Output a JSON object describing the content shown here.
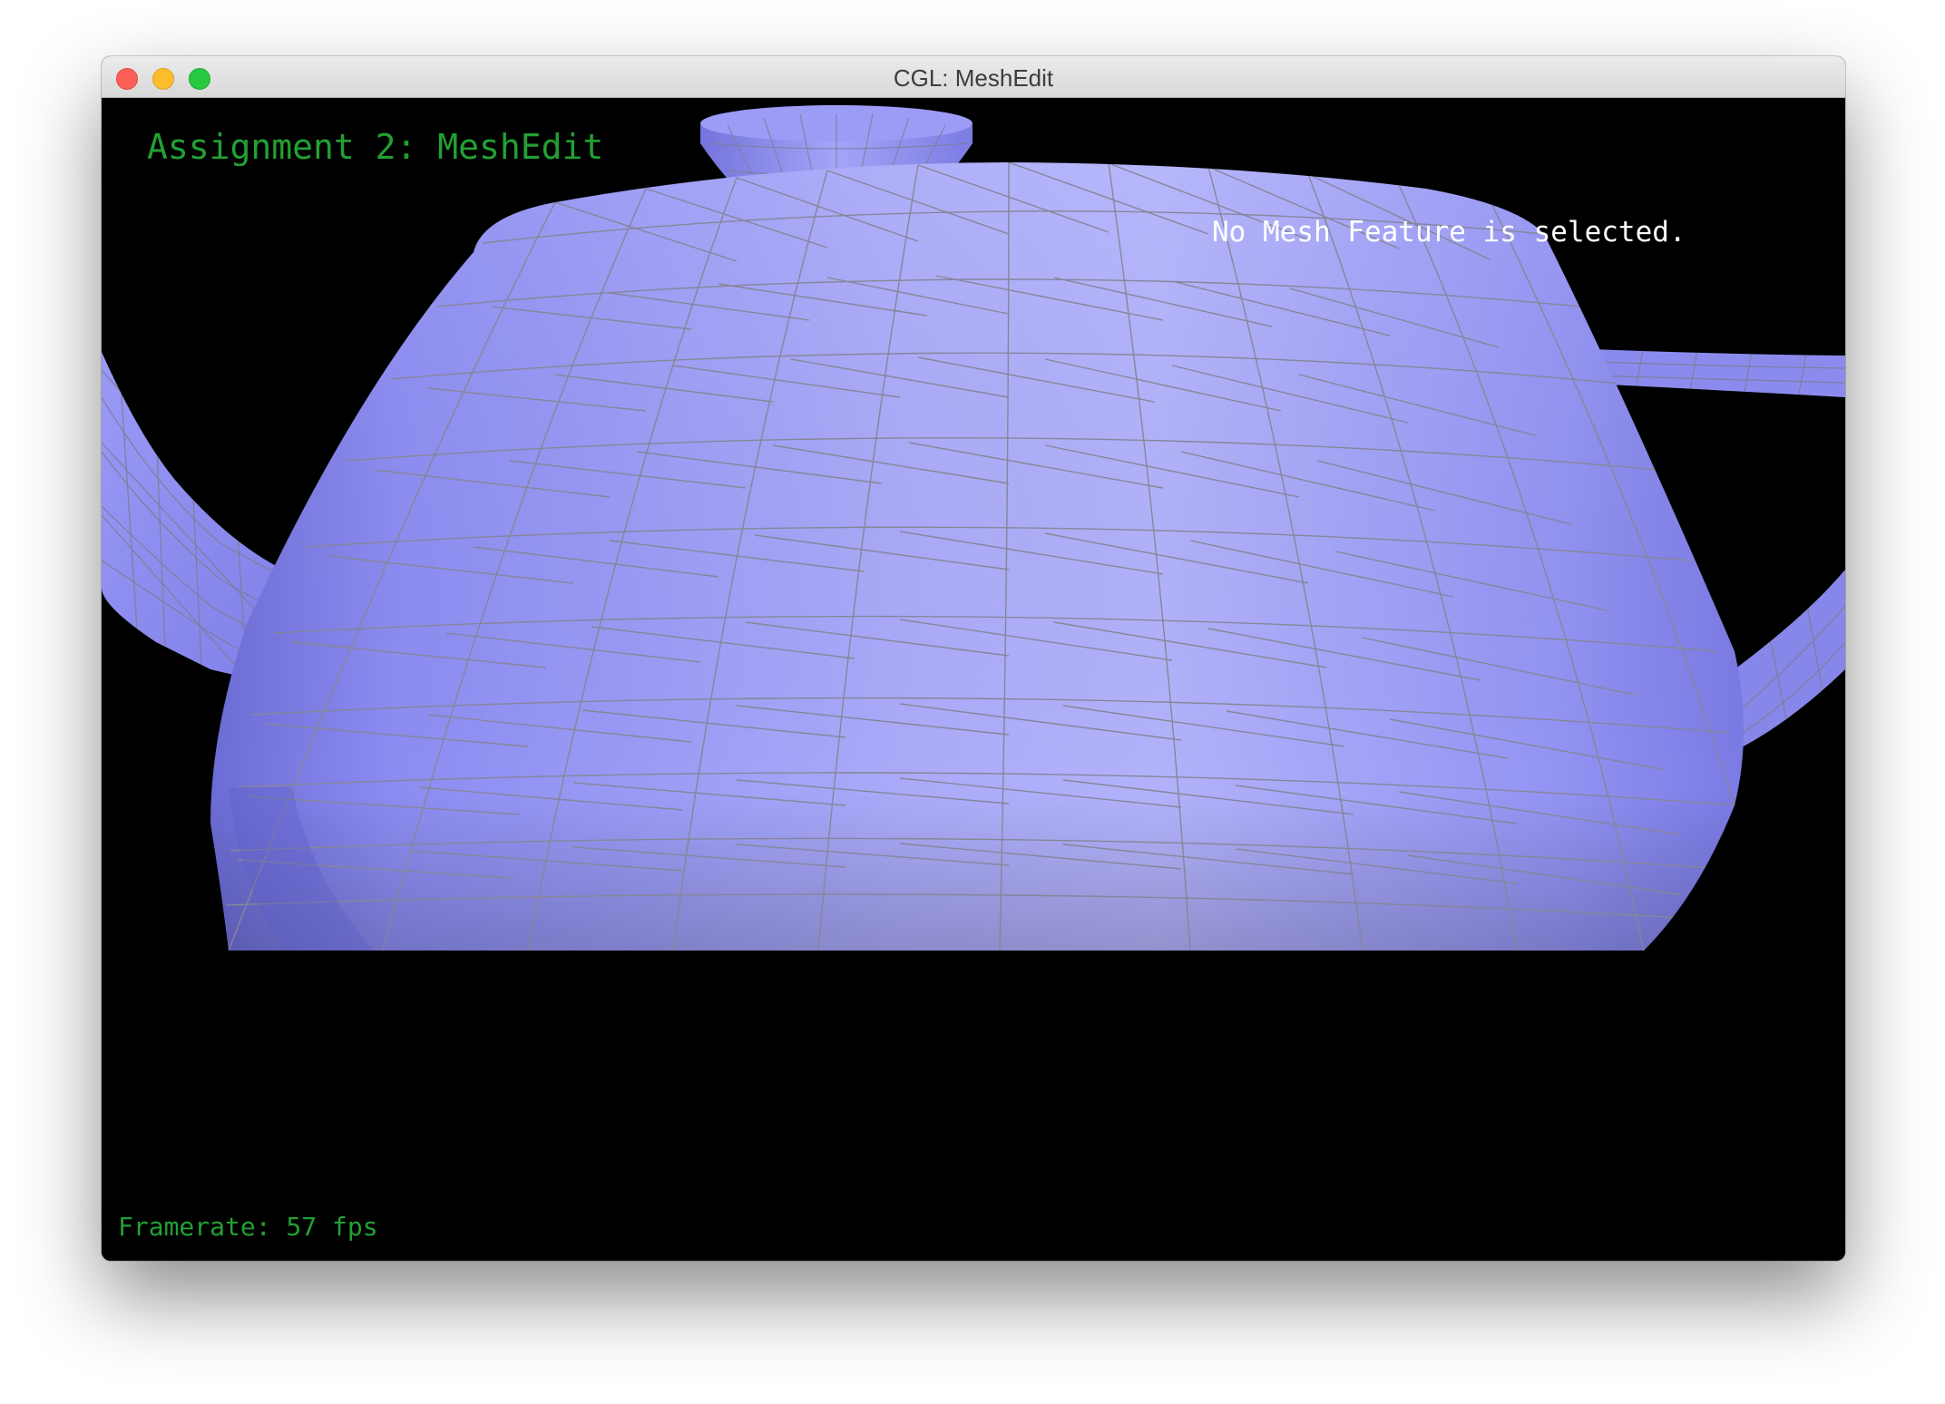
{
  "window": {
    "title": "CGL: MeshEdit"
  },
  "hud": {
    "heading": "Assignment 2: MeshEdit",
    "selection_status": "No Mesh Feature is selected.",
    "framerate": "Framerate: 57 fps"
  },
  "scene": {
    "model": "teapot-mesh",
    "background_color": "#000000",
    "mesh_color": "#a3a3f7",
    "wireframe_color": "#8a8a9a",
    "hud_accent_color": "#22a034"
  }
}
